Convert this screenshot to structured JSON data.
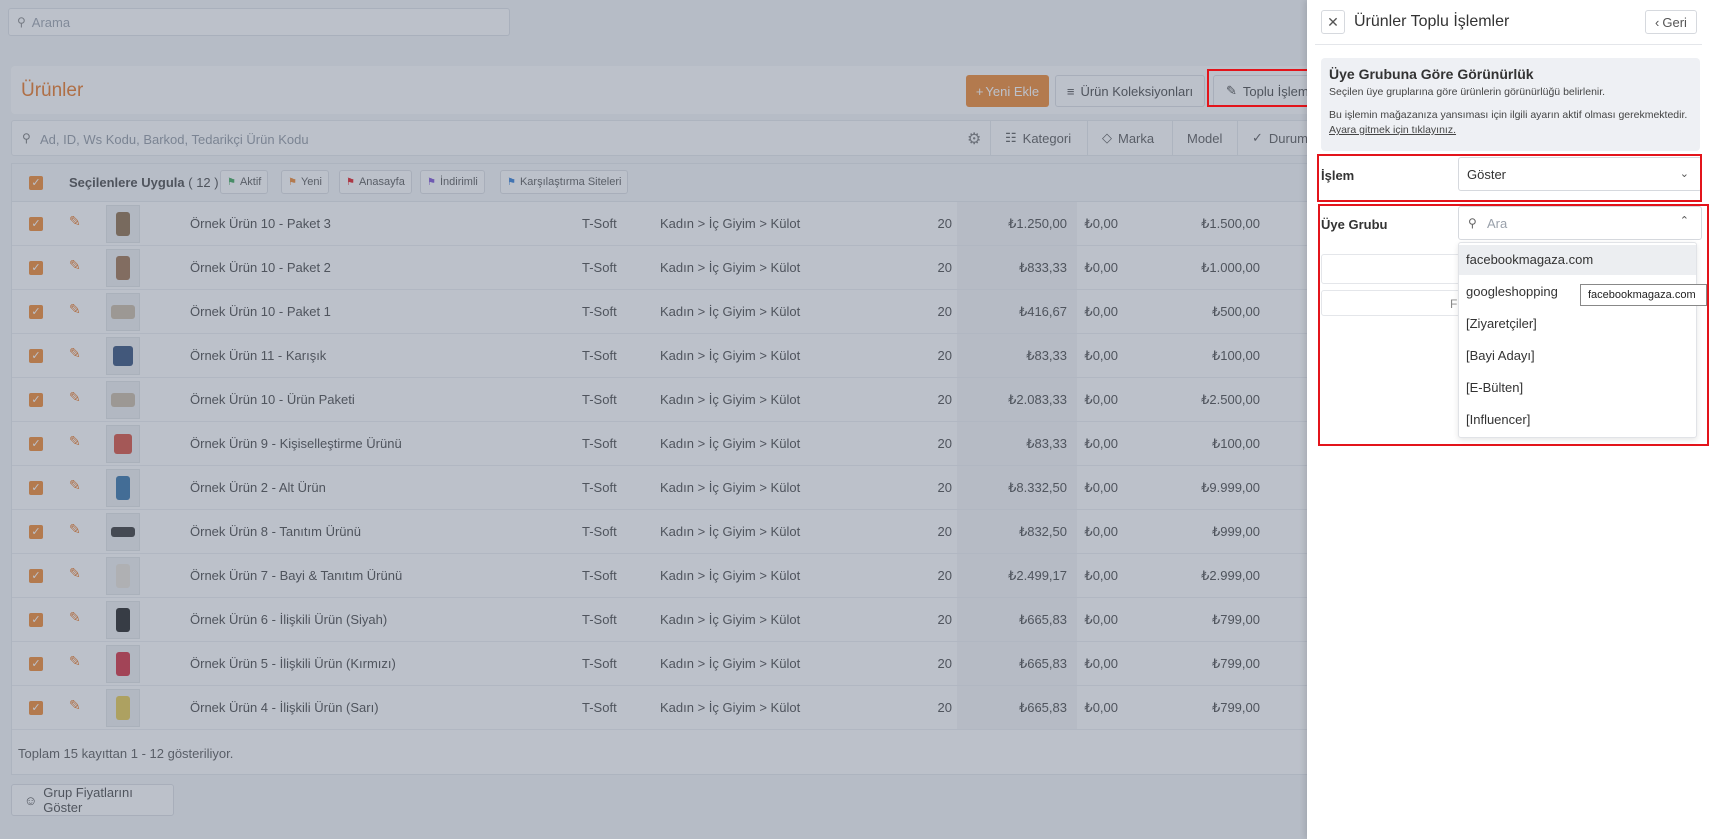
{
  "search": {
    "placeholder": "Arama"
  },
  "page": {
    "title": "Ürünler",
    "new_button": "Yeni Ekle",
    "collections_button": "Ürün Koleksiyonları",
    "bulk_button": "Toplu İşlemler"
  },
  "filter": {
    "placeholder": "Ad, ID, Ws Kodu, Barkod, Tedarikçi Ürün Kodu",
    "items": [
      "Kategori",
      "Marka",
      "Model",
      "Durum"
    ]
  },
  "table": {
    "apply_label": "Seçilenlere Uygula",
    "selected_count": "( 12 )",
    "tags": [
      "Aktif",
      "Yeni",
      "Anasayfa",
      "İndirimli",
      "Karşılaştırma Siteleri"
    ],
    "rows": [
      {
        "name": "Örnek Ürün 10 - Paket 3",
        "brand": "T-Soft",
        "category": "Kadın > İç Giyim > Külot",
        "stock": "20",
        "price": "₺1.250,00",
        "discount": "₺0,00",
        "sale": "₺1.500,00"
      },
      {
        "name": "Örnek Ürün 10 - Paket 2",
        "brand": "T-Soft",
        "category": "Kadın > İç Giyim > Külot",
        "stock": "20",
        "price": "₺833,33",
        "discount": "₺0,00",
        "sale": "₺1.000,00"
      },
      {
        "name": "Örnek Ürün 10 - Paket 1",
        "brand": "T-Soft",
        "category": "Kadın > İç Giyim > Külot",
        "stock": "20",
        "price": "₺416,67",
        "discount": "₺0,00",
        "sale": "₺500,00"
      },
      {
        "name": "Örnek Ürün 11 - Karışık",
        "brand": "T-Soft",
        "category": "Kadın > İç Giyim > Külot",
        "stock": "20",
        "price": "₺83,33",
        "discount": "₺0,00",
        "sale": "₺100,00"
      },
      {
        "name": "Örnek Ürün 10 - Ürün Paketi",
        "brand": "T-Soft",
        "category": "Kadın > İç Giyim > Külot",
        "stock": "20",
        "price": "₺2.083,33",
        "discount": "₺0,00",
        "sale": "₺2.500,00"
      },
      {
        "name": "Örnek Ürün 9 - Kişiselleştirme Ürünü",
        "brand": "T-Soft",
        "category": "Kadın > İç Giyim > Külot",
        "stock": "20",
        "price": "₺83,33",
        "discount": "₺0,00",
        "sale": "₺100,00"
      },
      {
        "name": "Örnek Ürün 2 - Alt Ürün",
        "brand": "T-Soft",
        "category": "Kadın > İç Giyim > Külot",
        "stock": "20",
        "price": "₺8.332,50",
        "discount": "₺0,00",
        "sale": "₺9.999,00"
      },
      {
        "name": "Örnek Ürün 8 - Tanıtım Ürünü",
        "brand": "T-Soft",
        "category": "Kadın > İç Giyim > Külot",
        "stock": "20",
        "price": "₺832,50",
        "discount": "₺0,00",
        "sale": "₺999,00"
      },
      {
        "name": "Örnek Ürün 7 - Bayi & Tanıtım Ürünü",
        "brand": "T-Soft",
        "category": "Kadın > İç Giyim > Külot",
        "stock": "20",
        "price": "₺2.499,17",
        "discount": "₺0,00",
        "sale": "₺2.999,00"
      },
      {
        "name": "Örnek Ürün 6 - İlişkili Ürün (Siyah)",
        "brand": "T-Soft",
        "category": "Kadın > İç Giyim > Külot",
        "stock": "20",
        "price": "₺665,83",
        "discount": "₺0,00",
        "sale": "₺799,00"
      },
      {
        "name": "Örnek Ürün 5 - İlişkili Ürün (Kırmızı)",
        "brand": "T-Soft",
        "category": "Kadın > İç Giyim > Külot",
        "stock": "20",
        "price": "₺665,83",
        "discount": "₺0,00",
        "sale": "₺799,00"
      },
      {
        "name": "Örnek Ürün 4 - İlişkili Ürün (Sarı)",
        "brand": "T-Soft",
        "category": "Kadın > İç Giyim > Külot",
        "stock": "20",
        "price": "₺665,83",
        "discount": "₺0,00",
        "sale": "₺799,00"
      }
    ],
    "footer": "Toplam 15 kayıttan 1 - 12 gösteriliyor."
  },
  "group_prices_button": "Grup Fiyatlarını Göster",
  "panel": {
    "title": "Ürünler Toplu İşlemler",
    "back": "Geri",
    "info_title": "Üye Grubuna Göre Görünürlük",
    "info_sub": "Seçilen üye gruplarına göre ürünlerin görünürlüğü belirlenir.",
    "info_note": "Bu işlemin mağazanıza yansıması için ilgili ayarın aktif olması gerekmektedir.",
    "info_link": "Ayara gitmek için tıklayınız.",
    "islem_label": "İşlem",
    "islem_value": "Göster",
    "uye_label": "Üye Grubu",
    "uye_placeholder": "Ara",
    "ghost_text": "Fi",
    "options": [
      "facebookmagaza.com",
      "googleshopping",
      "[Ziyaretçiler]",
      "[Bayi Adayı]",
      "[E-Bülten]",
      "[Influencer]"
    ],
    "tooltip": "facebookmagaza.com"
  },
  "colors": {
    "accent": "#f0852a",
    "highlight": "#e3141b"
  }
}
